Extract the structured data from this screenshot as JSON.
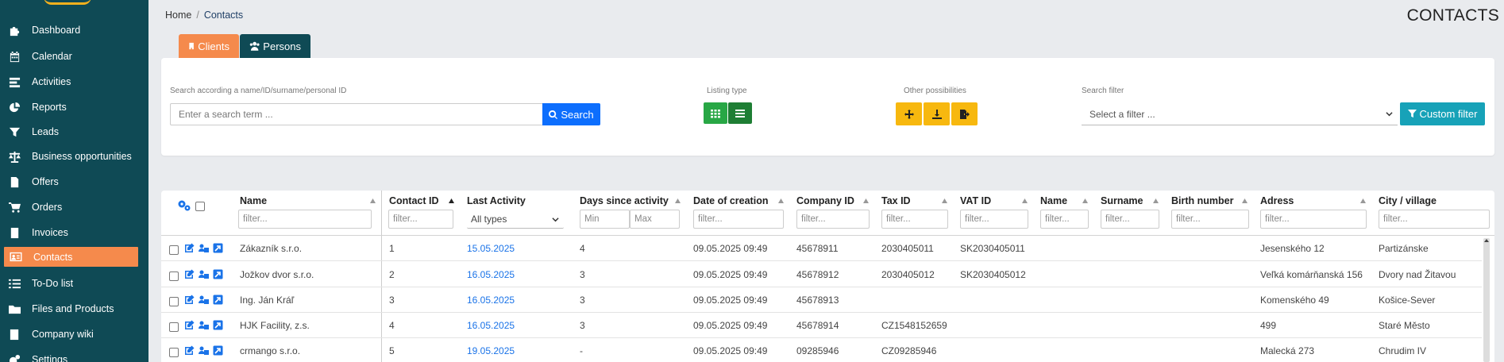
{
  "sidebar": {
    "items": [
      {
        "label": "Dashboard",
        "icon": "puzzle-icon"
      },
      {
        "label": "Calendar",
        "icon": "calendar-icon"
      },
      {
        "label": "Activities",
        "icon": "activities-icon"
      },
      {
        "label": "Reports",
        "icon": "pie-chart-icon"
      },
      {
        "label": "Leads",
        "icon": "funnel-icon"
      },
      {
        "label": "Business opportunities",
        "icon": "scales-icon"
      },
      {
        "label": "Offers",
        "icon": "document-icon"
      },
      {
        "label": "Orders",
        "icon": "cart-icon"
      },
      {
        "label": "Invoices",
        "icon": "invoice-icon"
      },
      {
        "label": "Contacts",
        "icon": "address-card-icon",
        "active": true
      },
      {
        "label": "To-Do list",
        "icon": "list-icon"
      },
      {
        "label": "Files and Products",
        "icon": "folder-icon"
      },
      {
        "label": "Company wiki",
        "icon": "book-icon"
      },
      {
        "label": "Settings",
        "icon": "gears-icon"
      }
    ]
  },
  "breadcrumb": {
    "home": "Home",
    "separator": "/",
    "current": "Contacts"
  },
  "page_title": "CONTACTS",
  "tabs": {
    "clients": "Clients",
    "persons": "Persons"
  },
  "search": {
    "label": "Search according a name/ID/surname/personal ID",
    "placeholder": "Enter a search term ...",
    "button": "Search"
  },
  "listing": {
    "label": "Listing type"
  },
  "other": {
    "label": "Other possibilities"
  },
  "filter": {
    "label": "Search filter",
    "placeholder": "Select a filter ...",
    "button": "Custom filter"
  },
  "table": {
    "columns": {
      "name": "Name",
      "contact_id": "Contact ID",
      "last_activity": "Last Activity",
      "days_since": "Days since activity",
      "date_created": "Date of creation",
      "company_id": "Company ID",
      "tax_id": "Tax ID",
      "vat_id": "VAT ID",
      "pname": "Name",
      "surname": "Surname",
      "birth": "Birth number",
      "adress": "Adress",
      "city": "City / village"
    },
    "filter_placeholder": "filter...",
    "activity_type": "All types",
    "min_placeholder": "Min",
    "max_placeholder": "Max",
    "rows": [
      {
        "name": "Zákazník s.r.o.",
        "contact_id": "1",
        "last_activity": "15.05.2025",
        "days": "4",
        "created": "09.05.2025 09:49",
        "company_id": "45678911",
        "tax_id": "2030405011",
        "vat_id": "SK2030405011",
        "adress": "Jesenského 12",
        "city": "Partizánske"
      },
      {
        "name": "Jožkov dvor s.r.o.",
        "contact_id": "2",
        "last_activity": "16.05.2025",
        "days": "3",
        "created": "09.05.2025 09:49",
        "company_id": "45678912",
        "tax_id": "2030405012",
        "vat_id": "SK2030405012",
        "adress": "Veľká komárňanská 156",
        "city": "Dvory nad Žitavou"
      },
      {
        "name": "Ing. Ján Kráľ",
        "contact_id": "3",
        "last_activity": "16.05.2025",
        "days": "3",
        "created": "09.05.2025 09:49",
        "company_id": "45678913",
        "tax_id": "",
        "vat_id": "",
        "adress": "Komenského 49",
        "city": "Košice-Sever"
      },
      {
        "name": "HJK Facility, z.s.",
        "contact_id": "4",
        "last_activity": "16.05.2025",
        "days": "3",
        "created": "09.05.2025 09:49",
        "company_id": "45678914",
        "tax_id": "CZ1548152659",
        "vat_id": "",
        "adress": "499",
        "city": "Staré Město"
      },
      {
        "name": "crmango s.r.o.",
        "contact_id": "5",
        "last_activity": "19.05.2025",
        "days": "-",
        "created": "09.05.2025 09:49",
        "company_id": "09285946",
        "tax_id": "CZ09285946",
        "vat_id": "",
        "adress": "Malecká 273",
        "city": "Chrudim IV"
      }
    ]
  }
}
